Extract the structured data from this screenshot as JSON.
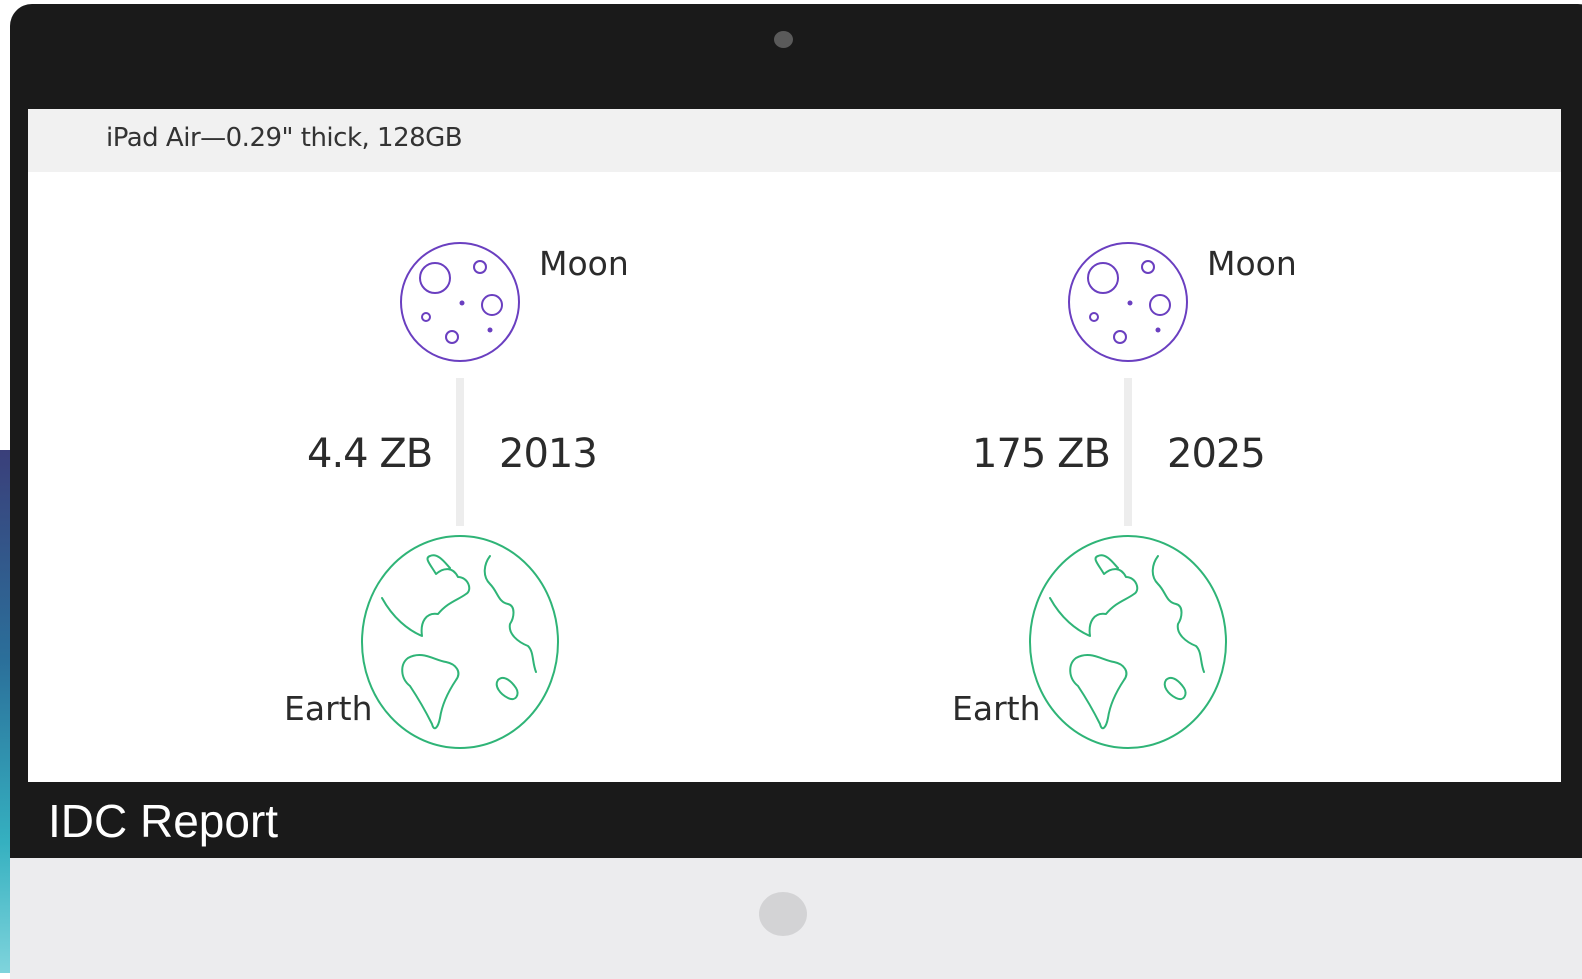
{
  "header": {
    "title": "iPad Air—0.29\" thick, 128GB"
  },
  "panels": [
    {
      "moon_label": "Moon",
      "earth_label": "Earth",
      "amount": "4.4 ZB",
      "year": "2013"
    },
    {
      "moon_label": "Moon",
      "earth_label": "Earth",
      "amount": "175 ZB",
      "year": "2025"
    }
  ],
  "caption": "IDC Report",
  "colors": {
    "moon": "#6a3fc0",
    "earth": "#2fb477",
    "connector": "#ededed",
    "bezel": "#1a1a1a",
    "screen_header": "#f1f1f1"
  },
  "icons": [
    "moon-icon",
    "earth-icon",
    "camera-icon",
    "home-button-icon"
  ]
}
